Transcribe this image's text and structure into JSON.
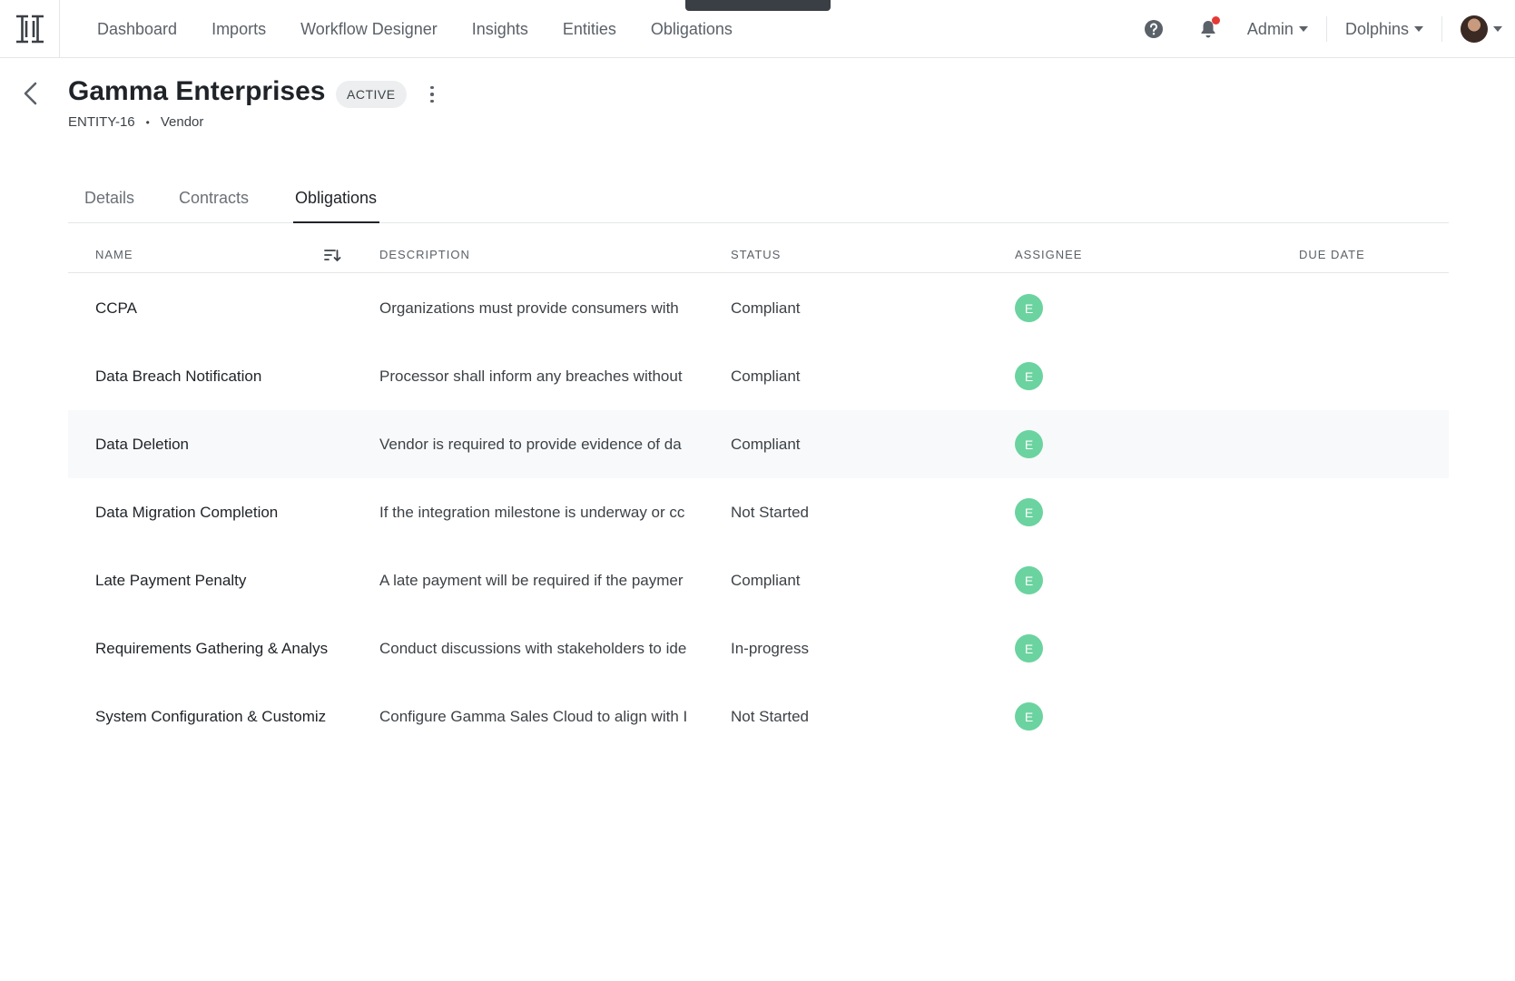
{
  "nav": {
    "links": [
      "Dashboard",
      "Imports",
      "Workflow Designer",
      "Insights",
      "Entities",
      "Obligations"
    ],
    "admin_label": "Admin",
    "org_label": "Dolphins",
    "icons": [
      "logo-icon",
      "help-icon",
      "bell-icon",
      "avatar"
    ]
  },
  "header": {
    "title": "Gamma Enterprises",
    "status_badge": "ACTIVE",
    "entity_id": "ENTITY-16",
    "separator": "•",
    "entity_type": "Vendor"
  },
  "tabs": [
    {
      "label": "Details",
      "active": false
    },
    {
      "label": "Contracts",
      "active": false
    },
    {
      "label": "Obligations",
      "active": true
    }
  ],
  "table": {
    "columns": [
      "NAME",
      "DESCRIPTION",
      "STATUS",
      "ASSIGNEE",
      "DUE DATE"
    ],
    "rows": [
      {
        "name": "CCPA",
        "description": "Organizations must provide consumers with",
        "status": "Compliant",
        "assignee": "E",
        "due_date": ""
      },
      {
        "name": "Data Breach Notification",
        "description": "Processor shall inform any breaches without",
        "status": "Compliant",
        "assignee": "E",
        "due_date": ""
      },
      {
        "name": "Data Deletion",
        "description": "Vendor is required to provide evidence of da",
        "status": "Compliant",
        "assignee": "E",
        "due_date": ""
      },
      {
        "name": "Data Migration Completion",
        "description": "If the integration milestone is underway or cc",
        "status": "Not Started",
        "assignee": "E",
        "due_date": ""
      },
      {
        "name": "Late Payment Penalty",
        "description": "A late payment will be required if the paymer",
        "status": "Compliant",
        "assignee": "E",
        "due_date": ""
      },
      {
        "name": "Requirements Gathering & Analys",
        "description": "Conduct discussions with stakeholders to ide",
        "status": "In-progress",
        "assignee": "E",
        "due_date": ""
      },
      {
        "name": "System Configuration & Customiz",
        "description": "Configure Gamma Sales Cloud to align with I",
        "status": "Not Started",
        "assignee": "E",
        "due_date": ""
      }
    ]
  },
  "colors": {
    "assignee_avatar": "#6bd39f",
    "notification_dot": "#e53935",
    "badge_bg": "#eceeef"
  }
}
